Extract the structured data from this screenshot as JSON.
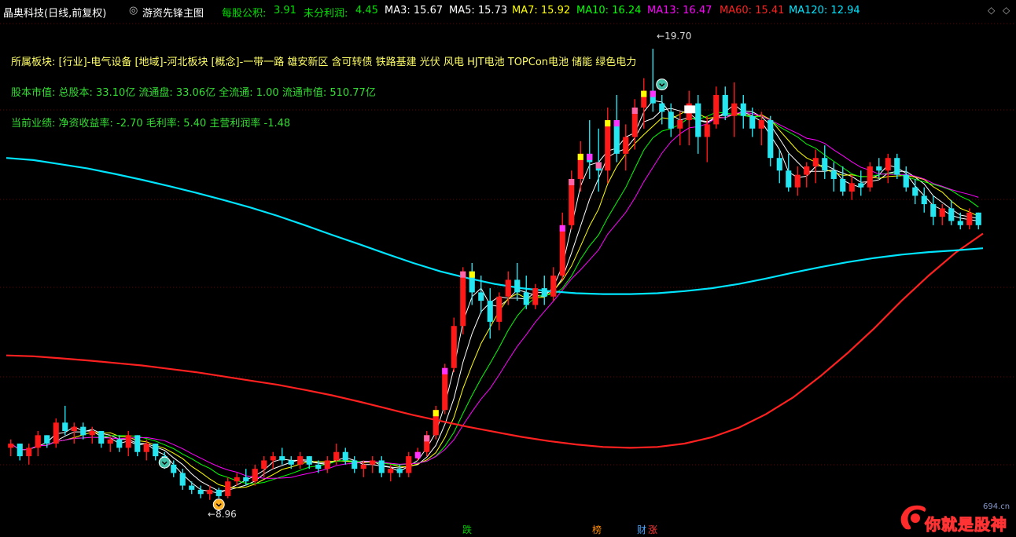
{
  "header": {
    "stock": "晶奥科技(日线,前复权)",
    "indicator": "游资先锋主图",
    "eps_label": "每股公积:",
    "eps_value": "3.91",
    "undist_label": "未分利润:",
    "undist_value": "4.45",
    "ma": [
      {
        "label": "MA3: 15.67",
        "color": "#ffffff"
      },
      {
        "label": "MA5: 15.73",
        "color": "#ffffff"
      },
      {
        "label": "MA7: 15.92",
        "color": "#ffff00"
      },
      {
        "label": "MA10: 16.24",
        "color": "#00ff00"
      },
      {
        "label": "MA13: 16.47",
        "color": "#ff00ff"
      },
      {
        "label": "MA60: 15.41",
        "color": "#ff2020"
      },
      {
        "label": "MA120: 12.94",
        "color": "#00e5ff"
      }
    ]
  },
  "info": {
    "sector": "所属板块: [行业]-电气设备 [地域]-河北板块 [概念]-一带一路 雄安新区 含可转债 铁路基建 光伏 风电 HJT电池 TOPCon电池 储能 绿色电力",
    "capital": "股本市值: 总股本: 33.10亿 流通盘: 33.06亿 全流通: 1.00 流通市值: 510.77亿",
    "perf": "当前业绩: 净资收益率: -2.70 毛利率: 5.40 主营利润率 -1.48"
  },
  "markers": {
    "high": "19.70",
    "low": "8.96"
  },
  "bottom_tags": [
    {
      "text": "跌",
      "color": "#00cc00"
    },
    {
      "text": "榜",
      "color": "#ff8c00"
    },
    {
      "text": "财",
      "color": "#4da6ff"
    },
    {
      "text": "涨",
      "color": "#ff3333"
    }
  ],
  "watermark": {
    "text": "你就是股神",
    "site": "694.cn"
  },
  "colors": {
    "up": "#ff1a1a",
    "down": "#25e5f0",
    "grid": "#6b0000"
  },
  "chart_data": {
    "type": "candlestick",
    "ylim": [
      8.6,
      20.3
    ],
    "candles": [
      [
        10.2,
        10.4,
        10.0,
        10.3
      ],
      [
        10.3,
        10.3,
        9.9,
        10.0
      ],
      [
        10.0,
        10.3,
        9.8,
        10.2
      ],
      [
        10.2,
        10.6,
        10.0,
        10.5
      ],
      [
        10.5,
        10.5,
        10.2,
        10.3
      ],
      [
        10.3,
        10.9,
        10.2,
        10.8
      ],
      [
        10.8,
        11.2,
        10.5,
        10.6
      ],
      [
        10.6,
        10.8,
        10.3,
        10.7
      ],
      [
        10.7,
        10.8,
        10.4,
        10.5
      ],
      [
        10.5,
        10.7,
        10.3,
        10.6
      ],
      [
        10.6,
        10.6,
        10.2,
        10.3
      ],
      [
        10.3,
        10.5,
        10.1,
        10.4
      ],
      [
        10.4,
        10.5,
        10.1,
        10.2
      ],
      [
        10.2,
        10.6,
        10.0,
        10.5
      ],
      [
        10.5,
        10.5,
        10.0,
        10.1
      ],
      [
        10.1,
        10.4,
        9.9,
        10.3
      ],
      [
        10.3,
        10.3,
        9.9,
        10.0
      ],
      [
        10.0,
        10.1,
        9.7,
        9.8
      ],
      [
        9.8,
        9.9,
        9.5,
        9.6
      ],
      [
        9.6,
        9.7,
        9.2,
        9.3
      ],
      [
        9.3,
        9.4,
        9.1,
        9.2
      ],
      [
        9.2,
        9.3,
        9.0,
        9.1
      ],
      [
        9.1,
        9.3,
        8.96,
        9.2
      ],
      [
        9.2,
        9.25,
        9.0,
        9.05
      ],
      [
        9.05,
        9.5,
        9.0,
        9.4
      ],
      [
        9.4,
        9.6,
        9.3,
        9.5
      ],
      [
        9.5,
        9.7,
        9.3,
        9.4
      ],
      [
        9.4,
        9.8,
        9.3,
        9.7
      ],
      [
        9.7,
        10.0,
        9.5,
        9.9
      ],
      [
        9.9,
        10.1,
        9.7,
        10.0
      ],
      [
        10.0,
        10.2,
        9.8,
        9.9
      ],
      [
        9.9,
        10.0,
        9.7,
        9.8
      ],
      [
        9.8,
        10.1,
        9.7,
        10.0
      ],
      [
        10.0,
        10.0,
        9.7,
        9.8
      ],
      [
        9.8,
        9.9,
        9.6,
        9.7
      ],
      [
        9.7,
        10.0,
        9.6,
        9.9
      ],
      [
        9.9,
        10.3,
        9.8,
        10.1
      ],
      [
        10.1,
        10.2,
        9.8,
        9.9
      ],
      [
        9.9,
        10.0,
        9.6,
        9.7
      ],
      [
        9.7,
        9.9,
        9.5,
        9.8
      ],
      [
        9.8,
        10.0,
        9.6,
        9.9
      ],
      [
        9.9,
        10.0,
        9.5,
        9.6
      ],
      [
        9.6,
        9.8,
        9.4,
        9.7
      ],
      [
        9.7,
        9.8,
        9.5,
        9.6
      ],
      [
        9.6,
        10.1,
        9.5,
        10.0
      ],
      [
        10.0,
        10.2,
        9.9,
        10.1
      ],
      [
        10.1,
        10.6,
        10.0,
        10.5
      ],
      [
        10.5,
        11.2,
        10.4,
        11.1
      ],
      [
        11.1,
        12.2,
        11.0,
        12.1
      ],
      [
        12.1,
        13.3,
        12.0,
        13.1
      ],
      [
        13.1,
        14.5,
        12.9,
        14.4
      ],
      [
        14.4,
        14.6,
        13.6,
        13.9
      ],
      [
        13.9,
        14.3,
        13.4,
        13.7
      ],
      [
        13.7,
        14.0,
        12.8,
        13.2
      ],
      [
        13.2,
        13.9,
        13.0,
        13.8
      ],
      [
        13.8,
        14.4,
        13.6,
        14.2
      ],
      [
        14.2,
        14.6,
        13.7,
        13.9
      ],
      [
        13.9,
        14.3,
        13.5,
        13.6
      ],
      [
        13.6,
        14.1,
        13.5,
        14.0
      ],
      [
        14.0,
        14.3,
        13.6,
        13.8
      ],
      [
        13.8,
        14.5,
        13.7,
        14.3
      ],
      [
        14.3,
        15.8,
        14.2,
        15.5
      ],
      [
        15.5,
        16.8,
        15.4,
        16.6
      ],
      [
        16.6,
        17.5,
        16.3,
        17.2
      ],
      [
        17.2,
        18.0,
        16.6,
        17.0
      ],
      [
        17.0,
        17.8,
        16.3,
        16.8
      ],
      [
        16.8,
        18.3,
        16.5,
        18.0
      ],
      [
        18.0,
        18.6,
        17.0,
        17.2
      ],
      [
        17.2,
        17.9,
        16.8,
        17.6
      ],
      [
        17.6,
        18.5,
        17.3,
        18.3
      ],
      [
        18.3,
        19.0,
        17.8,
        18.7
      ],
      [
        18.7,
        19.7,
        18.2,
        18.4
      ],
      [
        18.4,
        18.6,
        17.9,
        18.2
      ],
      [
        18.2,
        18.4,
        17.6,
        17.8
      ],
      [
        17.8,
        18.2,
        17.4,
        18.0
      ],
      [
        18.0,
        18.7,
        17.4,
        18.4
      ],
      [
        18.4,
        18.6,
        17.2,
        17.6
      ],
      [
        17.6,
        18.1,
        17.0,
        17.9
      ],
      [
        17.9,
        18.8,
        17.8,
        18.6
      ],
      [
        18.6,
        18.8,
        18.0,
        18.1
      ],
      [
        18.1,
        18.9,
        17.6,
        18.4
      ],
      [
        18.4,
        18.6,
        17.8,
        18.1
      ],
      [
        18.1,
        18.3,
        17.6,
        17.8
      ],
      [
        17.8,
        18.2,
        17.4,
        18.0
      ],
      [
        18.0,
        18.1,
        16.9,
        17.1
      ],
      [
        17.1,
        17.3,
        16.5,
        16.8
      ],
      [
        16.8,
        17.2,
        16.3,
        16.4
      ],
      [
        16.4,
        16.9,
        16.2,
        16.7
      ],
      [
        16.7,
        17.0,
        16.4,
        16.9
      ],
      [
        16.9,
        17.3,
        16.5,
        17.1
      ],
      [
        17.1,
        17.4,
        16.6,
        16.8
      ],
      [
        16.8,
        17.0,
        16.3,
        16.6
      ],
      [
        16.6,
        16.9,
        16.2,
        16.3
      ],
      [
        16.3,
        16.7,
        16.1,
        16.5
      ],
      [
        16.5,
        16.8,
        16.2,
        16.4
      ],
      [
        16.4,
        17.0,
        16.3,
        16.9
      ],
      [
        16.9,
        17.1,
        16.6,
        16.8
      ],
      [
        16.8,
        17.2,
        16.5,
        17.1
      ],
      [
        17.1,
        17.2,
        16.6,
        16.7
      ],
      [
        16.7,
        16.9,
        16.3,
        16.4
      ],
      [
        16.4,
        16.6,
        16.0,
        16.2
      ],
      [
        16.2,
        16.4,
        15.8,
        16.0
      ],
      [
        16.0,
        16.2,
        15.5,
        15.7
      ],
      [
        15.7,
        16.0,
        15.5,
        15.9
      ],
      [
        15.9,
        16.1,
        15.5,
        15.6
      ],
      [
        15.6,
        15.8,
        15.4,
        15.5
      ],
      [
        15.5,
        15.9,
        15.4,
        15.8
      ],
      [
        15.8,
        15.8,
        15.4,
        15.5
      ]
    ],
    "series": [
      {
        "name": "MA3",
        "color": "#ffffff"
      },
      {
        "name": "MA5",
        "color": "#ffffff"
      },
      {
        "name": "MA7",
        "color": "#ffff00"
      },
      {
        "name": "MA10",
        "color": "#00ff00"
      },
      {
        "name": "MA13",
        "color": "#ff00ff"
      },
      {
        "name": "MA60",
        "color": "#ff2020",
        "values": [
          12.4,
          12.38,
          12.33,
          12.28,
          12.22,
          12.16,
          12.08,
          12.0,
          11.9,
          11.8,
          11.7,
          11.58,
          11.45,
          11.3,
          11.14,
          10.98,
          10.84,
          10.7,
          10.58,
          10.46,
          10.36,
          10.28,
          10.22,
          10.2,
          10.22,
          10.3,
          10.45,
          10.68,
          11.0,
          11.4,
          11.9,
          12.45,
          13.05,
          13.7,
          14.3,
          14.85,
          15.3
        ]
      },
      {
        "name": "MA120",
        "color": "#00e5ff",
        "values": [
          17.1,
          17.05,
          16.95,
          16.85,
          16.72,
          16.58,
          16.43,
          16.27,
          16.1,
          15.92,
          15.72,
          15.5,
          15.27,
          15.05,
          14.82,
          14.6,
          14.4,
          14.24,
          14.1,
          14.0,
          13.93,
          13.88,
          13.86,
          13.86,
          13.88,
          13.93,
          14.0,
          14.1,
          14.23,
          14.37,
          14.5,
          14.62,
          14.72,
          14.8,
          14.86,
          14.9,
          14.95
        ]
      }
    ]
  }
}
